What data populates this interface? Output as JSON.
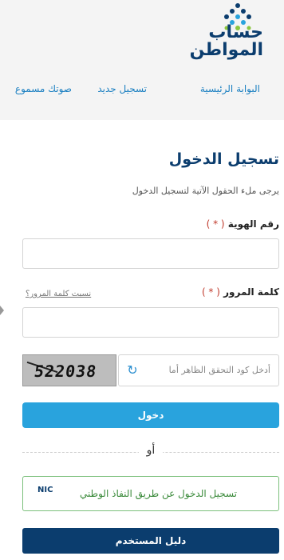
{
  "brand": {
    "logo_line1": "حساب",
    "logo_line2": "المواطن",
    "colors": {
      "primary": "#0b3d6e",
      "accent": "#29a3dd",
      "green": "#7cc07c"
    }
  },
  "nav": {
    "home": "البوابة الرئيسية",
    "register": "تسجيل جديد",
    "voice": "صوتك مسموع"
  },
  "login": {
    "title": "تسجيل الدخول",
    "subtitle": "يرجى ملء الحقول الآتية لتسجيل الدخول",
    "id_label": "رقم الهوية",
    "required_mark": "( * )",
    "password_label": "كلمة المرور",
    "forgot_password": "نسيت كلمة المرور؟",
    "captcha_code": "522038",
    "captcha_placeholder": "أدخل كود التحقق الظاهر أما",
    "submit_label": "دخول",
    "or_label": "أو",
    "nic_label": "تسجيل الدخول عن طريق النفاذ الوطني",
    "nic_logo": "NIC",
    "guide_label": "دليل المستخدم"
  },
  "icons": {
    "refresh": "refresh-icon",
    "logo_mark": "diamond-dots-icon"
  }
}
